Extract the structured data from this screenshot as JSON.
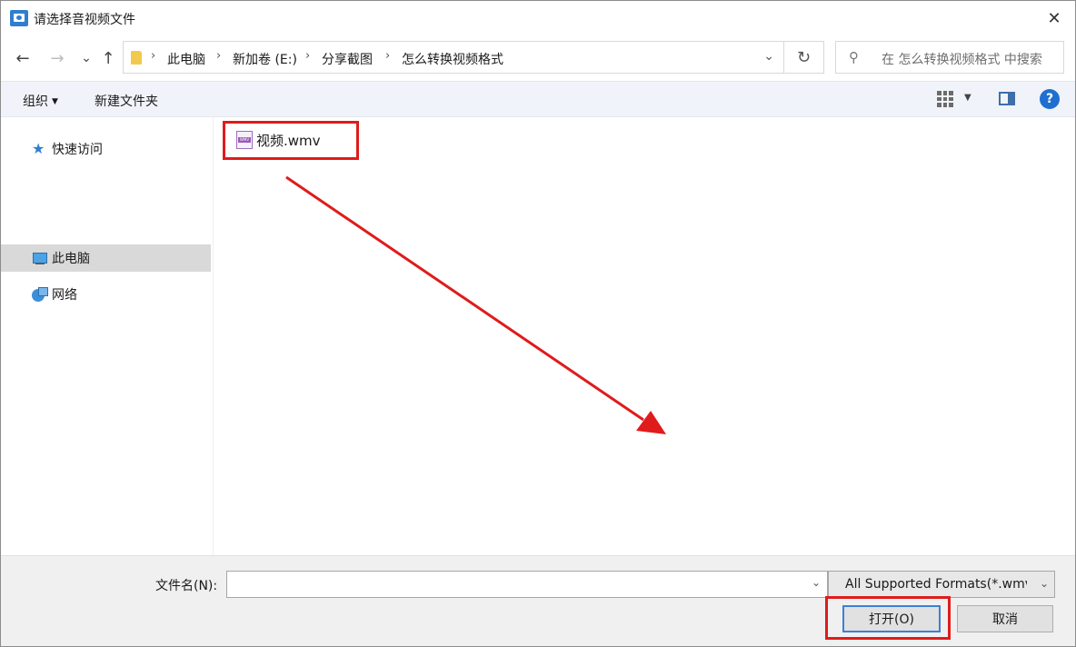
{
  "window": {
    "title": "请选择音视频文件",
    "close_glyph": "✕"
  },
  "nav": {
    "back_glyph": "←",
    "forward_glyph": "→",
    "recent_glyph": "⌄",
    "up_glyph": "↑"
  },
  "address": {
    "crumbs": [
      "此电脑",
      "新加卷 (E:)",
      "分享截图",
      "怎么转换视频格式"
    ],
    "separator": "›",
    "dropdown_glyph": "⌄"
  },
  "refresh_glyph": "↻",
  "search": {
    "placeholder": "在 怎么转换视频格式 中搜索",
    "icon": "search-icon",
    "icon_glyph": "⚲"
  },
  "commands": {
    "organize": "组织",
    "organize_arrow": "▼",
    "new_folder": "新建文件夹",
    "view_arrow": "▼",
    "help": "?"
  },
  "sidebar": {
    "items": [
      {
        "label": "快速访问",
        "icon": "star-icon",
        "glyph": "★"
      },
      {
        "label": "此电脑",
        "icon": "computer-icon",
        "selected": true
      },
      {
        "label": "网络",
        "icon": "network-icon"
      }
    ]
  },
  "files": [
    {
      "name": "视频.wmv",
      "type_badge": "WMV"
    }
  ],
  "footer": {
    "filename_label": "文件名(N):",
    "filename_value": "",
    "filename_caret": "⌄",
    "filetype_value": "All Supported Formats(*.wmv",
    "filetype_caret": "⌄",
    "open_button": "打开(O)",
    "cancel_button": "取消"
  },
  "annotation_color": "#e01b1b"
}
